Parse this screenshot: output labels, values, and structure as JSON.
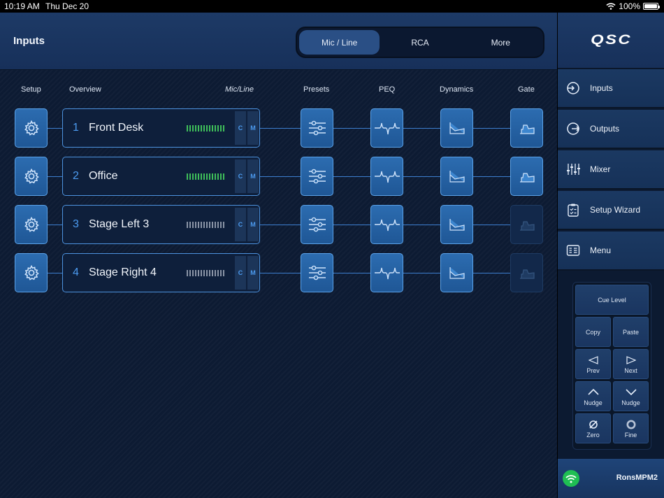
{
  "status_bar": {
    "time": "10:19 AM",
    "date": "Thu Dec 20",
    "battery": "100%"
  },
  "header": {
    "title": "Inputs",
    "tabs": [
      {
        "label": "Mic / Line",
        "active": true
      },
      {
        "label": "RCA",
        "active": false
      },
      {
        "label": "More",
        "active": false
      }
    ]
  },
  "columns": {
    "setup": "Setup",
    "overview": "Overview",
    "mic_line": "Mic/Line",
    "presets": "Presets",
    "peq": "PEQ",
    "dynamics": "Dynamics",
    "gate": "Gate"
  },
  "channels": [
    {
      "number": "1",
      "name": "Front Desk",
      "meter_active": true,
      "cue": "C",
      "mute": "M",
      "gate_enabled": true
    },
    {
      "number": "2",
      "name": "Office",
      "meter_active": true,
      "cue": "C",
      "mute": "M",
      "gate_enabled": true
    },
    {
      "number": "3",
      "name": "Stage Left 3",
      "meter_active": false,
      "cue": "C",
      "mute": "M",
      "gate_enabled": false
    },
    {
      "number": "4",
      "name": "Stage Right 4",
      "meter_active": false,
      "cue": "C",
      "mute": "M",
      "gate_enabled": false
    }
  ],
  "sidebar": {
    "logo": "QSC",
    "items": [
      {
        "label": "Inputs",
        "icon": "input-icon"
      },
      {
        "label": "Outputs",
        "icon": "output-icon"
      },
      {
        "label": "Mixer",
        "icon": "mixer-icon"
      },
      {
        "label": "Setup Wizard",
        "icon": "clipboard-icon"
      },
      {
        "label": "Menu",
        "icon": "menu-icon"
      }
    ],
    "pad": {
      "cue_level": "Cue Level",
      "copy": "Copy",
      "paste": "Paste",
      "prev": "Prev",
      "next": "Next",
      "nudge_up": "Nudge",
      "nudge_down": "Nudge",
      "zero": "Zero",
      "fine": "Fine"
    },
    "device": {
      "name": "RonsMPM2",
      "icon": "wifi-icon"
    }
  },
  "colors": {
    "accent": "#4c9bf0",
    "meter_active": "#3fbf5a",
    "meter_idle": "#8a94a6",
    "connected": "#1fbf53"
  }
}
